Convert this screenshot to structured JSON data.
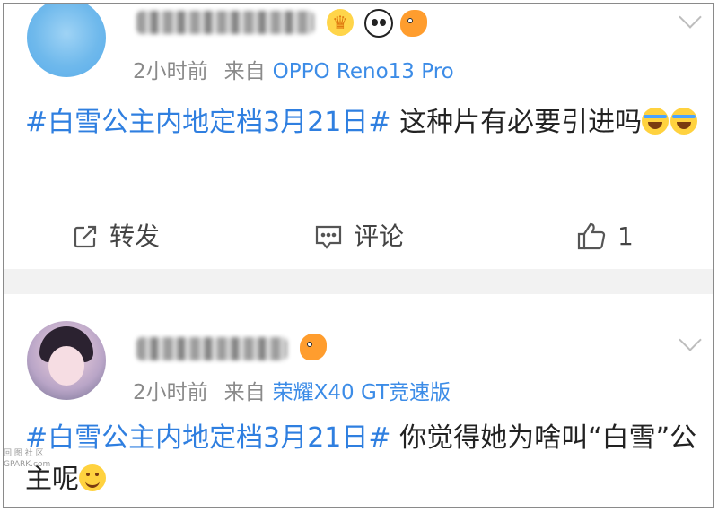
{
  "posts": [
    {
      "time": "2小时前",
      "from_label": "来自",
      "device": "OPPO Reno13 Pro",
      "hashtag": "#白雪公主内地定档3月21日#",
      "text": "这种片有必要引进吗",
      "emojis": [
        "laugh-cry-emoji",
        "laugh-cry-emoji"
      ],
      "actions": {
        "repost_label": "转发",
        "comment_label": "评论",
        "like_count": "1"
      }
    },
    {
      "time": "2小时前",
      "from_label": "来自",
      "device": "荣耀X40 GT竞速版",
      "hashtag": "#白雪公主内地定档3月21日#",
      "text": "你觉得她为啥叫“白雪”公主呢",
      "emojis": [
        "smile-emoji"
      ]
    }
  ],
  "watermark": {
    "line1": "回 图 社 区",
    "line2": "GPARK.com"
  },
  "colors": {
    "hashtag": "#2f7fe0",
    "device": "#3c8ce7",
    "meta": "#8a8a8a",
    "divider": "#f2f2f2"
  }
}
